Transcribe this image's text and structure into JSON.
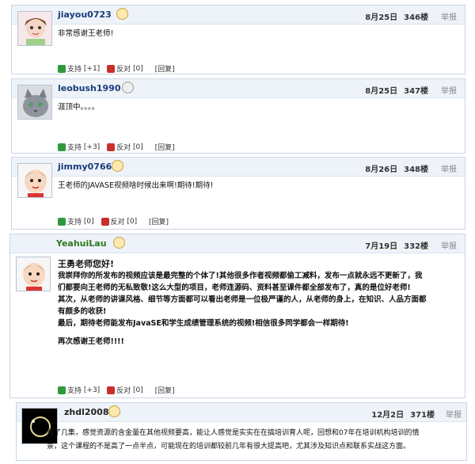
{
  "actions": {
    "support": "支持",
    "oppose": "反对",
    "reply": "[回复]",
    "report": "举报"
  },
  "posts": [
    {
      "username": "jiayou0723",
      "date": "8月25日",
      "floor": "346楼",
      "content": "非常感谢王老师!",
      "support_count": "[+1]",
      "oppose_count": "[0]"
    },
    {
      "username": "leobush1990",
      "date": "8月25日",
      "floor": "347楼",
      "content": "涯顶中。。。。",
      "support_count": "[+3]",
      "oppose_count": "[0]"
    },
    {
      "username": "jimmy0766",
      "date": "8月26日",
      "floor": "348楼",
      "content": "王老师的JAVASE视频啥时候出来啊!期待!期待!",
      "support_count": "[0]",
      "oppose_count": "[0]"
    },
    {
      "username": "YeahuiLau",
      "date": "7月19日",
      "floor": "332楼",
      "content_lines": [
        "王勇老师您好!",
        "我崇拜你的所发布的视频应该是最完整的个体了!其他很多作者视频都偷工减料，发布一点就永远不更新了，我",
        "们都要向王老师的无私致敬!这么大型的项目，老师连源码、资料甚至课件都全部发布了，真的是位好老师!",
        "其次，从老师的讲课风格、细节等方面都可以看出老师是一位极严谨的人，从老师的身上，在知识、人品方面都",
        "有颇多的收获!",
        "最后，期待老师能发布JavaSE和学生成绩管理系统的视频!相信很多同学都会一样期待!",
        "",
        "再次感谢王老师!!!!"
      ],
      "support_count": "[+3]",
      "oppose_count": "[0]"
    },
    {
      "username": "zhdl2008",
      "date": "12月2日",
      "floor": "371楼",
      "content_lines": [
        "看了几集，感觉资源的含金量在其他视频要高，能让人感觉是实实在在搞培训育人呢，回想和07年在培训机构培训的情",
        "景，这个课程的不是高了一点半点，可能现在的培训都较前几年有很大提高吧，尤其涉及知识点和联系实战这方面。"
      ]
    }
  ]
}
